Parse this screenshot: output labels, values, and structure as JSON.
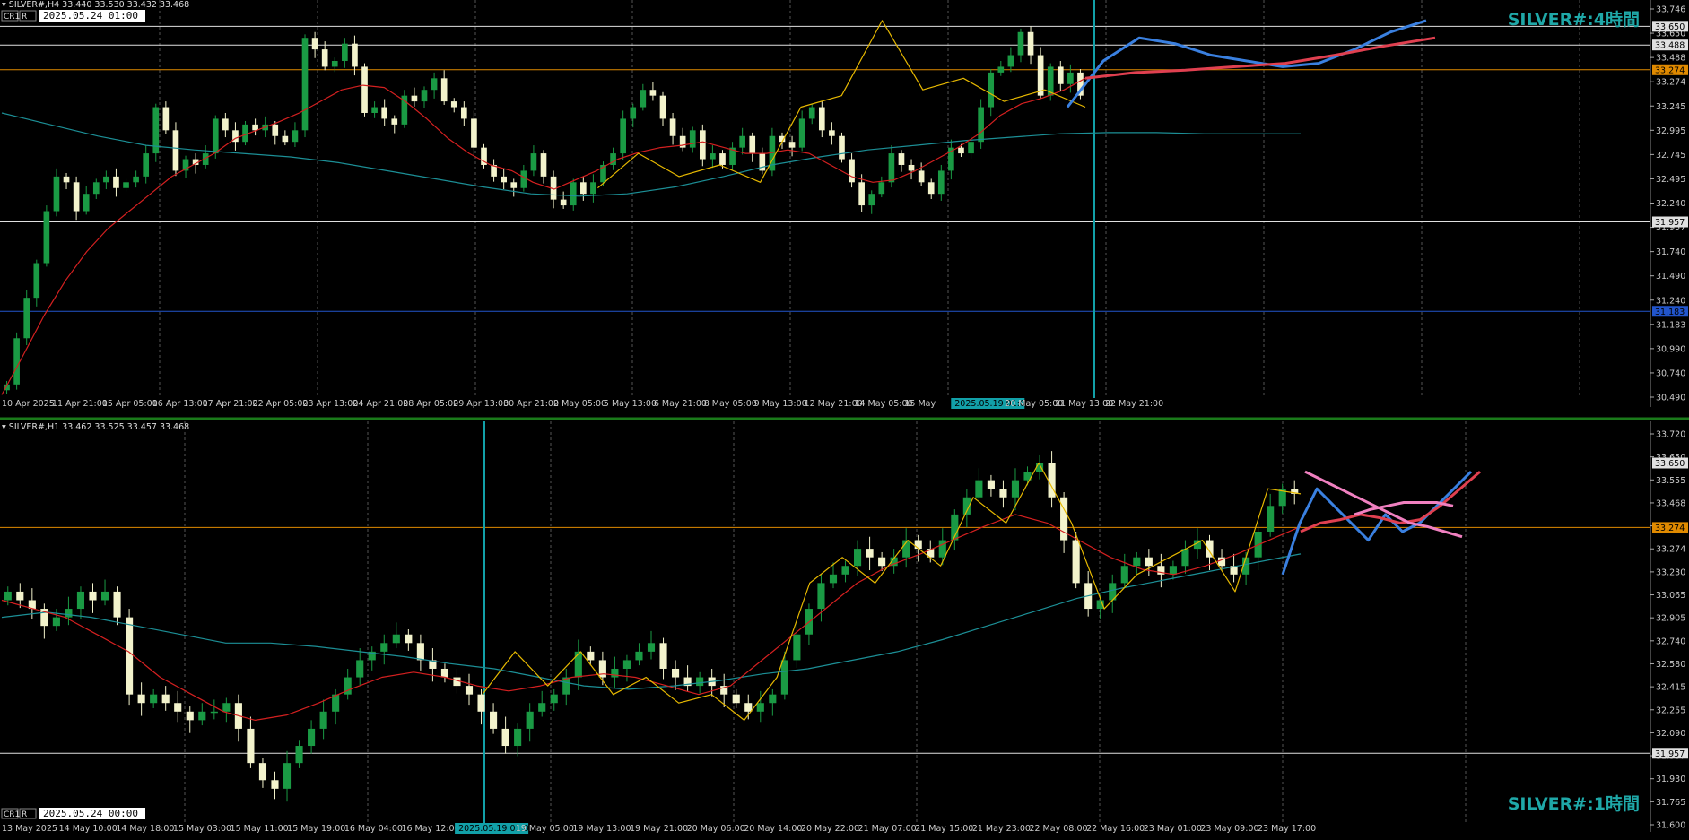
{
  "colors": {
    "background": "#000000",
    "grid": "#9a9a9a",
    "bull_body": "#1a9a44",
    "bear_body": "#f3f3cc",
    "ma_fast": "#d42020",
    "ma_slow": "#1c8f96",
    "zigzag": "#e6b800",
    "level_white": "#e0e0e0",
    "level_orange": "#e08a00",
    "level_blue": "#2255cc",
    "vline": "#12a0a8",
    "proj_blue": "#3a80e0",
    "proj_red": "#e04050",
    "proj_pink": "#f080c0",
    "watermark": "#1fa8a8"
  },
  "chart_data": [
    {
      "type": "candlestick",
      "symbol_header": "SILVER#,H4  33.440 33.530 33.432 33.468",
      "watermark": "SILVER#:4時間",
      "left_badges": [
        "CR1",
        "R"
      ],
      "time_box": "2025.05.24 01:00",
      "ylim": [
        30.44,
        33.8
      ],
      "y_ticks": [
        "33.746",
        "33.650",
        "33.488",
        "33.274",
        "33.245",
        "32.995",
        "32.745",
        "32.495",
        "32.240",
        "31.957",
        "31.740",
        "31.490",
        "31.240",
        "31.183",
        "30.990",
        "30.740",
        "30.490"
      ],
      "x_ticks": [
        "10 Apr 2025",
        "11 Apr 21:00",
        "15 Apr 05:00",
        "16 Apr 13:00",
        "17 Apr 21:00",
        "22 Apr 05:00",
        "23 Apr 13:00",
        "24 Apr 21:00",
        "28 Apr 05:00",
        "29 Apr 13:00",
        "30 Apr 21:00",
        "2 May 05:00",
        "5 May 13:00",
        "6 May 21:00",
        "8 May 05:00",
        "9 May 13:00",
        "12 May 21:00",
        "14 May 05:00",
        "15 May",
        "2025.05.19 01:00",
        "20 May 05:00",
        "21 May 13:00",
        "22 May 21:00"
      ],
      "cursor_time_label": "2025.05.19 01:00",
      "levels": [
        {
          "price": 33.65,
          "label": "33.650",
          "color": "white"
        },
        {
          "price": 33.488,
          "label": "33.488",
          "color": "white"
        },
        {
          "price": 33.274,
          "label": "33.274",
          "color": "orange"
        },
        {
          "price": 31.957,
          "label": "31.957",
          "color": "white"
        },
        {
          "price": 31.183,
          "label": "31.183",
          "color": "blue"
        }
      ],
      "closes": [
        30.55,
        30.95,
        31.3,
        31.6,
        32.05,
        32.35,
        32.3,
        32.05,
        32.2,
        32.3,
        32.35,
        32.25,
        32.3,
        32.35,
        32.55,
        32.95,
        32.75,
        32.4,
        32.5,
        32.45,
        32.55,
        32.85,
        32.75,
        32.65,
        32.8,
        32.75,
        32.8,
        32.7,
        32.65,
        32.75,
        33.55,
        33.45,
        33.3,
        33.35,
        33.5,
        33.3,
        32.9,
        32.95,
        32.85,
        32.8,
        33.05,
        33.0,
        33.1,
        33.2,
        33.0,
        32.95,
        32.85,
        32.6,
        32.45,
        32.35,
        32.3,
        32.25,
        32.4,
        32.55,
        32.35,
        32.15,
        32.1,
        32.3,
        32.2,
        32.3,
        32.45,
        32.55,
        32.85,
        32.95,
        33.1,
        33.05,
        32.85,
        32.7,
        32.6,
        32.75,
        32.5,
        32.55,
        32.45,
        32.6,
        32.7,
        32.55,
        32.4,
        32.7,
        32.65,
        32.6,
        32.85,
        32.95,
        32.75,
        32.7,
        32.5,
        32.3,
        32.1,
        32.2,
        32.3,
        32.55,
        32.45,
        32.4,
        32.3,
        32.2,
        32.4,
        32.6,
        32.55,
        32.65,
        32.95,
        33.25,
        33.3,
        33.4,
        33.6,
        33.4,
        33.05,
        33.3,
        33.15,
        33.25,
        33.05
      ],
      "ma_fast": [
        30.46,
        30.8,
        31.15,
        31.45,
        31.7,
        31.9,
        32.05,
        32.2,
        32.35,
        32.45,
        32.55,
        32.68,
        32.75,
        32.82,
        32.9,
        33.0,
        33.1,
        33.14,
        33.12,
        33.0,
        32.85,
        32.68,
        32.55,
        32.45,
        32.4,
        32.3,
        32.24,
        32.32,
        32.4,
        32.5,
        32.56,
        32.6,
        32.62,
        32.65,
        32.6,
        32.55,
        32.55,
        32.58,
        32.55,
        32.45,
        32.35,
        32.3,
        32.32,
        32.4,
        32.5,
        32.6,
        32.72,
        32.88,
        32.98,
        33.03,
        33.1,
        33.2
      ],
      "ma_slow": [
        32.9,
        32.8,
        32.7,
        32.62,
        32.58,
        32.55,
        32.52,
        32.47,
        32.4,
        32.33,
        32.26,
        32.2,
        32.18,
        32.2,
        32.26,
        32.35,
        32.45,
        32.52,
        32.58,
        32.62,
        32.66,
        32.69,
        32.72,
        32.73,
        32.73,
        32.72,
        32.72,
        32.72
      ],
      "zigzag": [
        32.25,
        32.55,
        32.35,
        32.45,
        32.3,
        32.95,
        33.05,
        33.7,
        33.1,
        33.2,
        33.0,
        33.1,
        32.95
      ],
      "projection_blue": [
        32.95,
        33.35,
        33.55,
        33.5,
        33.4,
        33.35,
        33.3,
        33.33,
        33.45,
        33.6,
        33.7
      ],
      "projection_red": [
        33.2,
        33.25,
        33.27,
        33.3,
        33.33,
        33.4,
        33.48,
        33.55
      ]
    },
    {
      "type": "candlestick",
      "symbol_header": "SILVER#,H1  33.462 33.525 33.457 33.468",
      "watermark": "SILVER#:1時間",
      "left_badges": [
        "CR1",
        "R"
      ],
      "time_box": "2025.05.24 00:00",
      "ylim": [
        31.54,
        33.82
      ],
      "y_ticks": [
        "33.720",
        "33.650",
        "33.555",
        "33.468",
        "33.395",
        "33.274",
        "33.230",
        "33.065",
        "32.905",
        "32.740",
        "32.580",
        "32.415",
        "32.255",
        "32.090",
        "31.957",
        "31.930",
        "31.765",
        "31.600"
      ],
      "x_ticks": [
        "13 May 2025",
        "14 May 10:00",
        "14 May 18:00",
        "15 May 03:00",
        "15 May 11:00",
        "15 May 19:00",
        "16 May 04:00",
        "16 May 12:00",
        "2025.05.19 01:00",
        "19 May 05:00",
        "19 May 13:00",
        "19 May 21:00",
        "20 May 06:00",
        "20 May 14:00",
        "20 May 22:00",
        "21 May 07:00",
        "21 May 15:00",
        "21 May 23:00",
        "22 May 08:00",
        "22 May 16:00",
        "23 May 01:00",
        "23 May 09:00",
        "23 May 17:00"
      ],
      "cursor_time_label": "2025.05.19 01:00",
      "levels": [
        {
          "price": 33.65,
          "label": "33.650",
          "color": "white"
        },
        {
          "price": 33.274,
          "label": "33.274",
          "color": "orange"
        },
        {
          "price": 31.957,
          "label": "31.957",
          "color": "white"
        }
      ],
      "closes": [
        32.9,
        32.85,
        32.8,
        32.7,
        32.75,
        32.8,
        32.9,
        32.85,
        32.9,
        32.75,
        32.3,
        32.25,
        32.3,
        32.25,
        32.2,
        32.15,
        32.2,
        32.2,
        32.25,
        32.1,
        31.9,
        31.8,
        31.75,
        31.9,
        32.0,
        32.1,
        32.2,
        32.3,
        32.4,
        32.5,
        32.55,
        32.6,
        32.65,
        32.6,
        32.5,
        32.45,
        32.4,
        32.35,
        32.3,
        32.2,
        32.1,
        32.0,
        32.1,
        32.2,
        32.25,
        32.3,
        32.4,
        32.55,
        32.5,
        32.4,
        32.45,
        32.5,
        32.55,
        32.6,
        32.45,
        32.4,
        32.35,
        32.4,
        32.35,
        32.3,
        32.25,
        32.2,
        32.25,
        32.3,
        32.5,
        32.65,
        32.8,
        32.95,
        33.0,
        33.05,
        33.15,
        33.1,
        33.05,
        33.1,
        33.2,
        33.15,
        33.1,
        33.2,
        33.35,
        33.45,
        33.55,
        33.5,
        33.45,
        33.55,
        33.6,
        33.65,
        33.45,
        33.2,
        32.95,
        32.8,
        32.85,
        32.95,
        33.05,
        33.1,
        33.05,
        33.0,
        33.05,
        33.15,
        33.2,
        33.1,
        33.05,
        33.0,
        33.1,
        33.25,
        33.4,
        33.5,
        33.47
      ],
      "ma_fast": [
        32.85,
        32.8,
        32.75,
        32.65,
        32.55,
        32.4,
        32.3,
        32.2,
        32.15,
        32.18,
        32.25,
        32.33,
        32.4,
        32.43,
        32.4,
        32.35,
        32.32,
        32.35,
        32.4,
        32.42,
        32.4,
        32.35,
        32.3,
        32.35,
        32.5,
        32.65,
        32.8,
        32.95,
        33.05,
        33.12,
        33.2,
        33.28,
        33.35,
        33.3,
        33.2,
        33.1,
        33.03,
        33.0,
        33.05,
        33.12,
        33.2,
        33.28
      ],
      "ma_slow": [
        32.75,
        32.78,
        32.75,
        32.7,
        32.65,
        32.6,
        32.6,
        32.58,
        32.55,
        32.52,
        32.48,
        32.45,
        32.4,
        32.35,
        32.33,
        32.35,
        32.38,
        32.42,
        32.45,
        32.5,
        32.55,
        32.62,
        32.7,
        32.78,
        32.86,
        32.92,
        32.97,
        33.02,
        33.07,
        33.12
      ],
      "zigzag": [
        32.3,
        32.55,
        32.35,
        32.55,
        32.3,
        32.4,
        32.25,
        32.3,
        32.15,
        32.4,
        32.95,
        33.1,
        32.95,
        33.2,
        33.05,
        33.45,
        33.3,
        33.65,
        33.3,
        32.8,
        33.0,
        33.1,
        33.2,
        32.9,
        33.5,
        33.47
      ],
      "projection_blue": [
        33.0,
        33.3,
        33.5,
        33.4,
        33.3,
        33.2,
        33.35,
        33.25,
        33.3,
        33.4,
        33.5,
        33.6
      ],
      "projection_red": [
        33.25,
        33.3,
        33.32,
        33.35,
        33.33,
        33.3,
        33.32,
        33.4,
        33.5,
        33.6
      ],
      "projection_pink": [
        33.6,
        33.55,
        33.5,
        33.45,
        33.4,
        33.35,
        33.3,
        33.28,
        33.25,
        33.22
      ],
      "projection_pink2": [
        33.35,
        33.38,
        33.4,
        33.42,
        33.42,
        33.42,
        33.4
      ]
    }
  ]
}
